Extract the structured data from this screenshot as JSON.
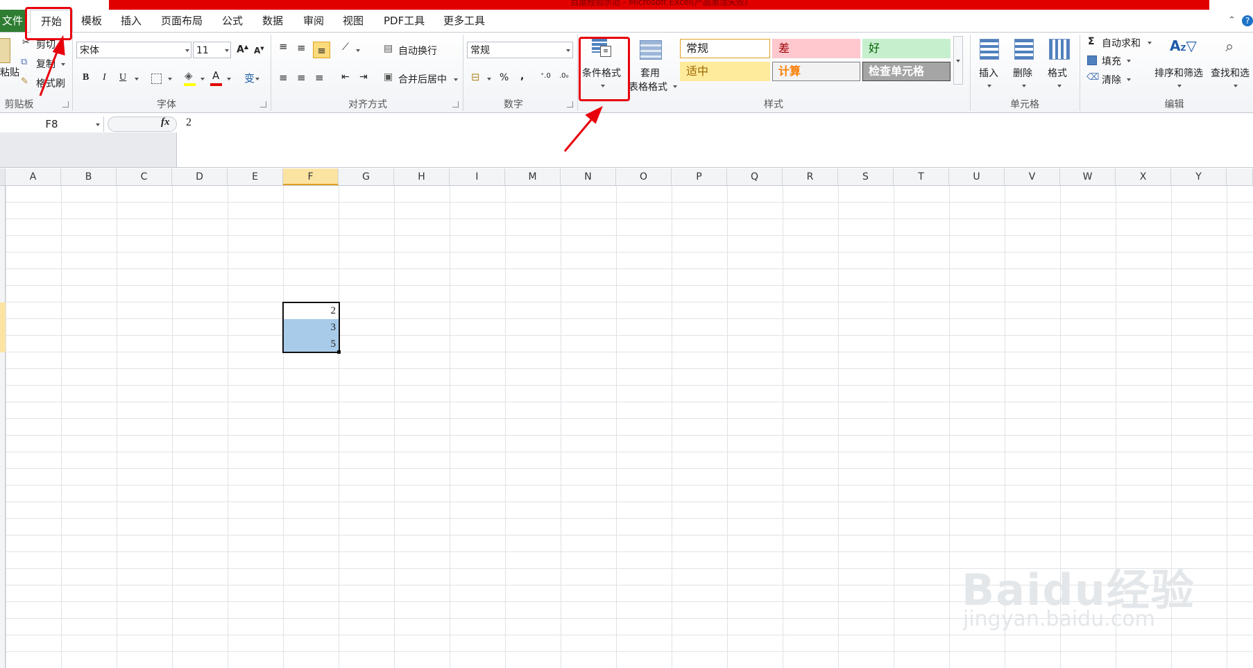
{
  "window": {
    "title": "百度经验示范 - Microsoft Excel(产品激活失败)"
  },
  "menu": {
    "file": "文件",
    "tabs": [
      "开始",
      "模板",
      "插入",
      "页面布局",
      "公式",
      "数据",
      "审阅",
      "视图",
      "PDF工具",
      "更多工具"
    ]
  },
  "clipboard": {
    "paste": "粘贴",
    "cut": "剪切",
    "copy": "复制",
    "format_painter": "格式刷",
    "group": "剪贴板"
  },
  "font": {
    "name": "宋体",
    "size": "11",
    "group": "字体",
    "bold": "B",
    "italic": "I",
    "underline": "U",
    "color_a": "A",
    "wen": "变"
  },
  "alignment": {
    "wrap": "自动换行",
    "merge": "合并后居中",
    "group": "对齐方式"
  },
  "number": {
    "format": "常规",
    "percent": "%",
    "comma": ",",
    "group": "数字"
  },
  "styles": {
    "conditional": "条件格式",
    "table_line1": "套用",
    "table_line2": "表格格式",
    "cells": [
      {
        "label": "常规",
        "bg": "#ffffff",
        "fg": "#222222",
        "border": "#e0a020"
      },
      {
        "label": "差",
        "bg": "#ffc7ce",
        "fg": "#9c0006",
        "border": "#ffc7ce"
      },
      {
        "label": "好",
        "bg": "#c6efce",
        "fg": "#006100",
        "border": "#c6efce"
      },
      {
        "label": "适中",
        "bg": "#ffeb9c",
        "fg": "#9c6500",
        "border": "#ffeb9c"
      },
      {
        "label": "计算",
        "bg": "#f2f2f2",
        "fg": "#fa7d00",
        "border": "#7f7f7f"
      },
      {
        "label": "检查单元格",
        "bg": "#a5a5a5",
        "fg": "#ffffff",
        "border": "#3f3f3f"
      }
    ],
    "group": "样式"
  },
  "cells_group": {
    "insert": "插入",
    "delete": "删除",
    "format": "格式",
    "group": "单元格"
  },
  "editing": {
    "autosum": "自动求和",
    "fill": "填充",
    "clear": "清除",
    "sort": "排序和筛选",
    "find": "查找和选",
    "group": "编辑"
  },
  "formula_bar": {
    "name_box": "F8",
    "fx": "fx",
    "value": "2"
  },
  "columns": [
    "A",
    "B",
    "C",
    "D",
    "E",
    "F",
    "G",
    "H",
    "I",
    "M",
    "N",
    "O",
    "P",
    "Q",
    "R",
    "S",
    "T",
    "U",
    "V",
    "W",
    "X",
    "Y"
  ],
  "selected_column": "F",
  "cells": [
    {
      "ref": "F8",
      "value": "2",
      "selected": true,
      "fill": "#ffffff"
    },
    {
      "ref": "F9",
      "value": "3",
      "selected": true,
      "fill": "#a9cbea"
    },
    {
      "ref": "F10",
      "value": "5",
      "selected": true,
      "fill": "#a9cbea"
    }
  ],
  "watermark": {
    "brand": "Baidu经验",
    "url": "jingyan.baidu.com"
  },
  "colors": {
    "accent_red": "#e8000b",
    "file_tab": "#2e7d32",
    "selection": "#a9cbea"
  }
}
